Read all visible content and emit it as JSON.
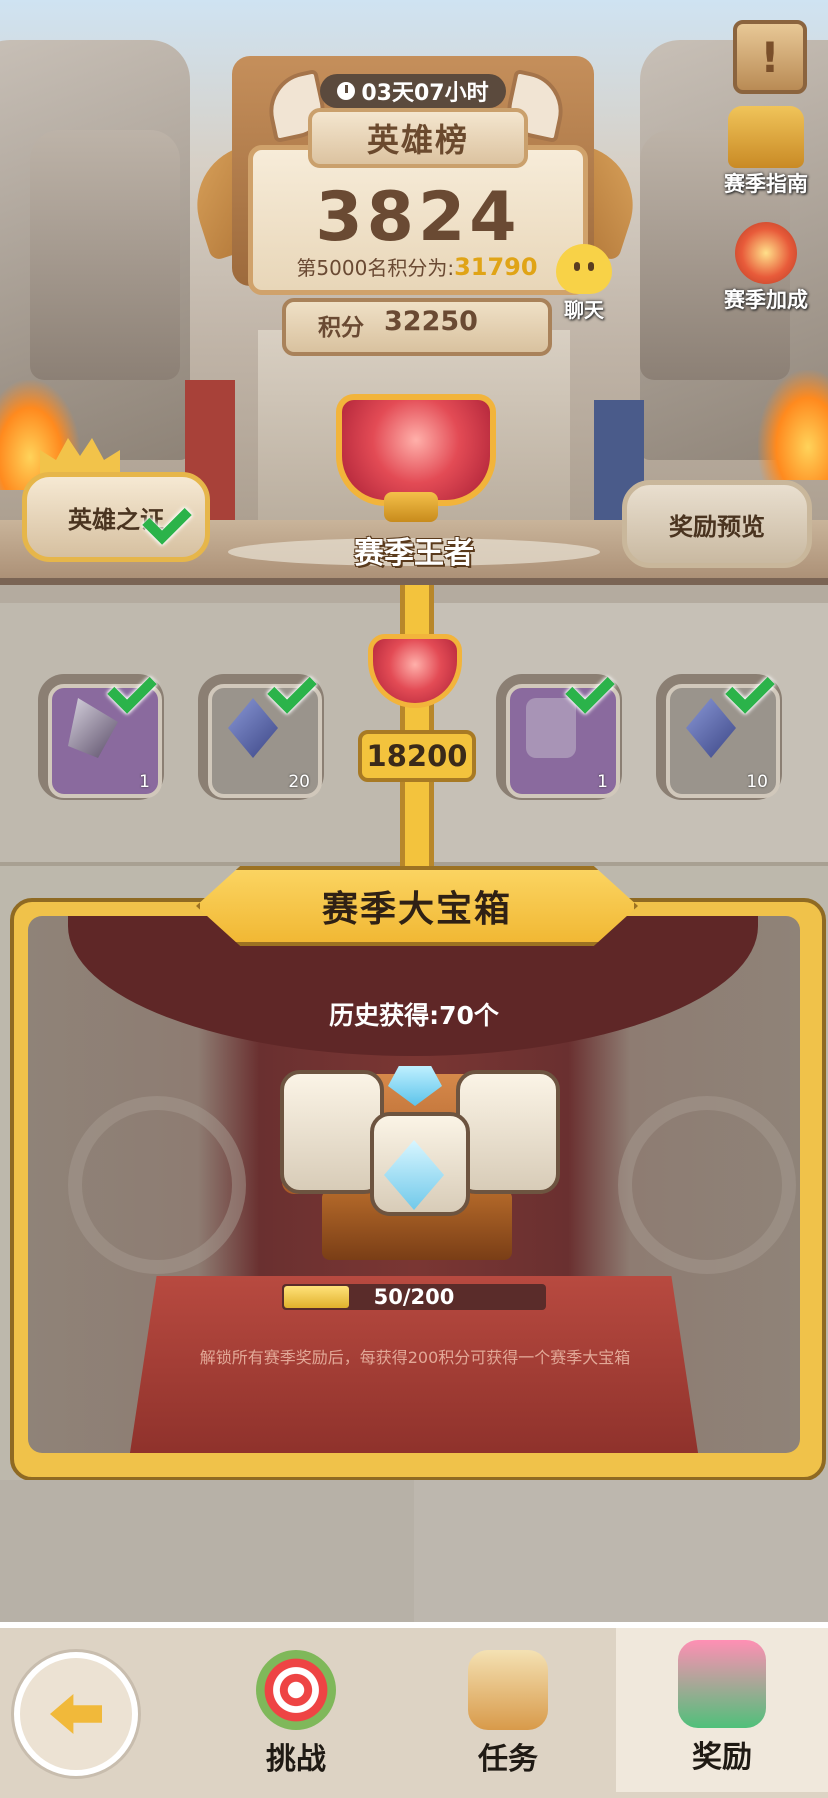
{
  "event": {
    "timer": "03天07小时",
    "title": "英雄榜",
    "rank": "3824",
    "rank_line_prefix": "第5000名积分为:",
    "rank_line_value": "31790",
    "score_label": "积分",
    "score_value": "32250"
  },
  "side": {
    "guide_label": "赛季指南",
    "bonus_label": "赛季加成",
    "chat_label": "聊天"
  },
  "center": {
    "title": "赛季王者"
  },
  "buttons": {
    "proof_label": "英雄之证",
    "rewards_label": "奖励预览"
  },
  "track": {
    "milestone": "18200",
    "slots": [
      {
        "count": "1",
        "claimed": true
      },
      {
        "count": "20",
        "claimed": true
      },
      {
        "count": "1",
        "claimed": true
      },
      {
        "count": "10",
        "claimed": true
      }
    ]
  },
  "chest": {
    "title": "赛季大宝箱",
    "history": "历史获得:70个",
    "progress_text": "50/200",
    "progress_fraction": 0.25,
    "hint": "解锁所有赛季奖励后，每获得200积分可获得一个赛季大宝箱"
  },
  "nav": {
    "challenge": "挑战",
    "task": "任务",
    "reward": "奖励"
  },
  "colors": {
    "accent_gold": "#f3c33d",
    "check_green": "#2bb34a",
    "rank_gold": "#e0a416"
  }
}
